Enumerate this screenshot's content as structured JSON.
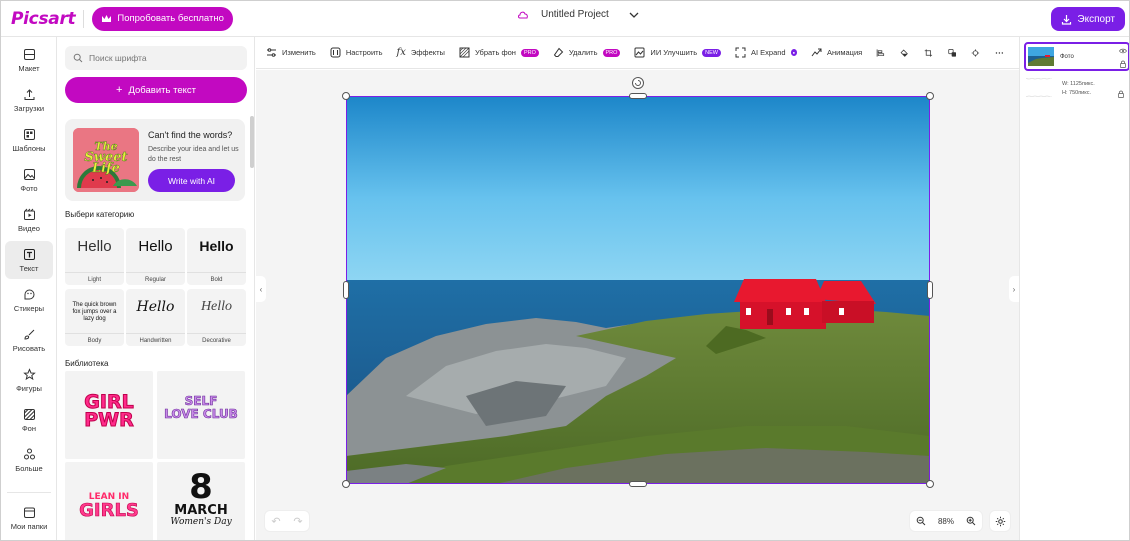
{
  "header": {
    "logo": "Picsart",
    "try_button": "Попробовать бесплатно",
    "project_title": "Untitled Project",
    "export_button": "Экспорт"
  },
  "rail": {
    "items": [
      {
        "label": "Макет",
        "icon": "layout-icon"
      },
      {
        "label": "Загрузки",
        "icon": "upload-icon"
      },
      {
        "label": "Шаблоны",
        "icon": "templates-icon"
      },
      {
        "label": "Фото",
        "icon": "photo-icon"
      },
      {
        "label": "Видео",
        "icon": "video-icon"
      },
      {
        "label": "Текст",
        "icon": "text-icon"
      },
      {
        "label": "Стикеры",
        "icon": "sticker-icon"
      },
      {
        "label": "Рисовать",
        "icon": "brush-icon"
      },
      {
        "label": "Фигуры",
        "icon": "star-icon"
      },
      {
        "label": "Фон",
        "icon": "background-icon"
      },
      {
        "label": "Больше",
        "icon": "more-grid-icon"
      },
      {
        "label": "Мои папки",
        "icon": "folder-icon"
      }
    ],
    "active": "Текст"
  },
  "panel": {
    "search_placeholder": "Поиск шрифта",
    "add_text_button": "Добавить текст",
    "promo": {
      "image_text": "The Sweet Life",
      "title": "Can't find the words?",
      "description": "Describe your idea and let us do the rest",
      "button": "Write with AI"
    },
    "category_title": "Выбери категорию",
    "styles": [
      {
        "sample": "Hello",
        "caption": "Light"
      },
      {
        "sample": "Hello",
        "caption": "Regular"
      },
      {
        "sample": "Hello",
        "caption": "Bold"
      },
      {
        "sample": "The quick brown fox jumps over a lazy dog",
        "caption": "Body"
      },
      {
        "sample": "Hello",
        "caption": "Handwritten"
      },
      {
        "sample": "Hello",
        "caption": "Decorative"
      }
    ],
    "library_title": "Библиотека",
    "library": [
      {
        "line1": "GIRL",
        "line2": "PWR",
        "color": "#ff2a8a"
      },
      {
        "line1": "SELF",
        "line2": "LOVE CLUB",
        "color": "#c98be8"
      },
      {
        "line1": "LEAN IN",
        "line2": "GIRLS",
        "color": "#ff3a8c"
      },
      {
        "line1": "8",
        "line2": "MARCH",
        "line3": "Women's Day",
        "color": "#111111"
      }
    ]
  },
  "toolbar": {
    "tools": [
      {
        "label": "Изменить",
        "icon": "edit-icon"
      },
      {
        "label": "Настроить",
        "icon": "adjust-icon"
      },
      {
        "label": "Эффекты",
        "icon": "fx-icon"
      },
      {
        "label": "Убрать фон",
        "icon": "remove-bg-icon",
        "badge": "PRO",
        "badge_color": "#c209c1"
      },
      {
        "label": "Удалить",
        "icon": "eraser-icon",
        "badge": "PRO",
        "badge_color": "#c209c1"
      },
      {
        "label": "ИИ Улучшить",
        "icon": "ai-enhance-icon",
        "badge": "NEW",
        "badge_color": "#7a1fe6"
      },
      {
        "label": "AI Expand",
        "icon": "ai-expand-icon",
        "badge": "●",
        "badge_color": "#7a1fe6"
      },
      {
        "label": "Анимация",
        "icon": "animation-icon"
      }
    ],
    "icon_tools": [
      "align-icon",
      "fill-icon",
      "crop-icon",
      "replace-icon",
      "arrange-icon",
      "more-icon"
    ]
  },
  "canvas": {
    "zoom": "88%",
    "image_alt": "Red house on a coastal cliff by the sea"
  },
  "layers": [
    {
      "name": "Фото",
      "type": "photo",
      "selected": true
    },
    {
      "w": "W: 1125пикс.",
      "h": "H: 750пикс.",
      "type": "blank",
      "selected": false
    }
  ]
}
